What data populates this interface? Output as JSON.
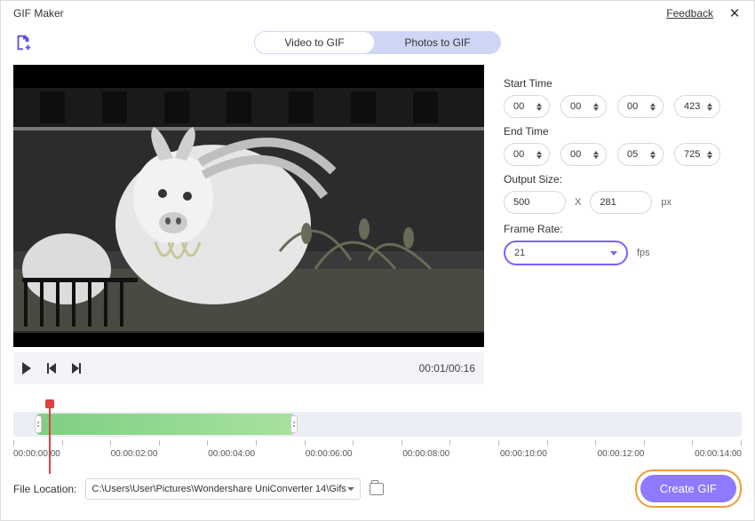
{
  "titlebar": {
    "title": "GIF Maker",
    "feedback": "Feedback"
  },
  "tabs": {
    "video": "Video to GIF",
    "photos": "Photos to GIF"
  },
  "playback": {
    "time": "00:01/00:16"
  },
  "settings": {
    "start_label": "Start Time",
    "start": {
      "h": "00",
      "m": "00",
      "s": "00",
      "ms": "423"
    },
    "end_label": "End Time",
    "end": {
      "h": "00",
      "m": "00",
      "s": "05",
      "ms": "725"
    },
    "outsize_label": "Output Size:",
    "out_w": "500",
    "out_x": "X",
    "out_h": "281",
    "px": "px",
    "fps_label": "Frame Rate:",
    "fps_value": "21",
    "fps_unit": "fps"
  },
  "ruler": [
    "00:00:00:00",
    "00:00:02:00",
    "00:00:04:00",
    "00:00:06:00",
    "00:00:08:00",
    "00:00:10:00",
    "00:00:12:00",
    "00:00:14:00"
  ],
  "bottom": {
    "file_loc_label": "File Location:",
    "file_path": "C:\\Users\\User\\Pictures\\Wondershare UniConverter 14\\Gifs",
    "create": "Create GIF"
  }
}
